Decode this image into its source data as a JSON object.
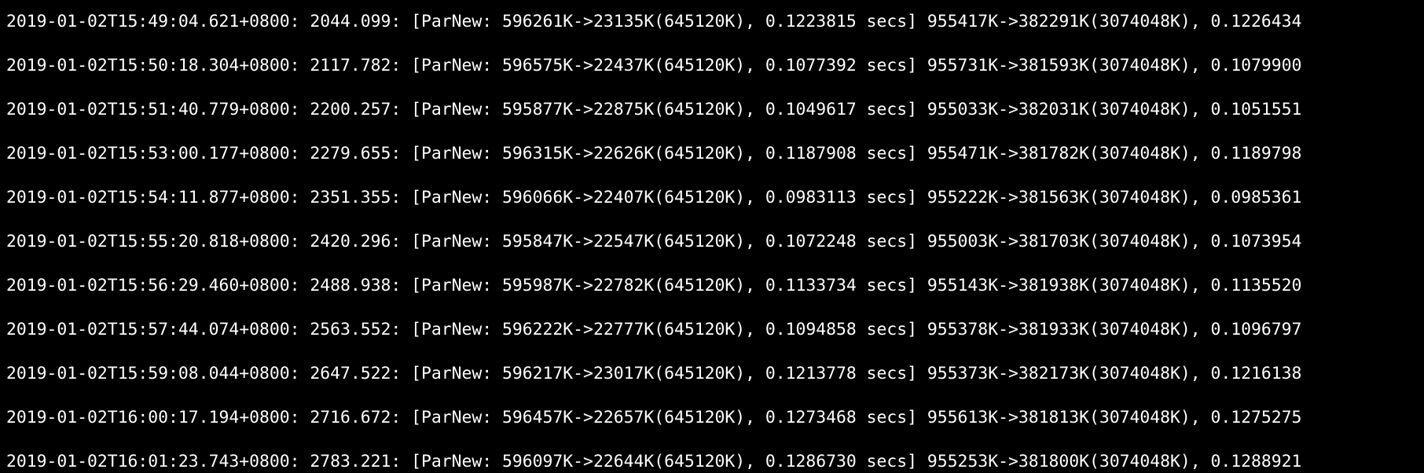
{
  "terminal": {
    "lines": [
      "2019-01-02T15:49:04.621+0800: 2044.099: [ParNew: 596261K->23135K(645120K), 0.1223815 secs] 955417K->382291K(3074048K), 0.1226434",
      "2019-01-02T15:50:18.304+0800: 2117.782: [ParNew: 596575K->22437K(645120K), 0.1077392 secs] 955731K->381593K(3074048K), 0.1079900",
      "2019-01-02T15:51:40.779+0800: 2200.257: [ParNew: 595877K->22875K(645120K), 0.1049617 secs] 955033K->382031K(3074048K), 0.1051551",
      "2019-01-02T15:53:00.177+0800: 2279.655: [ParNew: 596315K->22626K(645120K), 0.1187908 secs] 955471K->381782K(3074048K), 0.1189798",
      "2019-01-02T15:54:11.877+0800: 2351.355: [ParNew: 596066K->22407K(645120K), 0.0983113 secs] 955222K->381563K(3074048K), 0.0985361",
      "2019-01-02T15:55:20.818+0800: 2420.296: [ParNew: 595847K->22547K(645120K), 0.1072248 secs] 955003K->381703K(3074048K), 0.1073954",
      "2019-01-02T15:56:29.460+0800: 2488.938: [ParNew: 595987K->22782K(645120K), 0.1133734 secs] 955143K->381938K(3074048K), 0.1135520",
      "2019-01-02T15:57:44.074+0800: 2563.552: [ParNew: 596222K->22777K(645120K), 0.1094858 secs] 955378K->381933K(3074048K), 0.1096797",
      "2019-01-02T15:59:08.044+0800: 2647.522: [ParNew: 596217K->23017K(645120K), 0.1213778 secs] 955373K->382173K(3074048K), 0.1216138",
      "2019-01-02T16:00:17.194+0800: 2716.672: [ParNew: 596457K->22657K(645120K), 0.1273468 secs] 955613K->381813K(3074048K), 0.1275275",
      "2019-01-02T16:01:23.743+0800: 2783.221: [ParNew: 596097K->22644K(645120K), 0.1286730 secs] 955253K->381800K(3074048K), 0.1288921"
    ]
  }
}
